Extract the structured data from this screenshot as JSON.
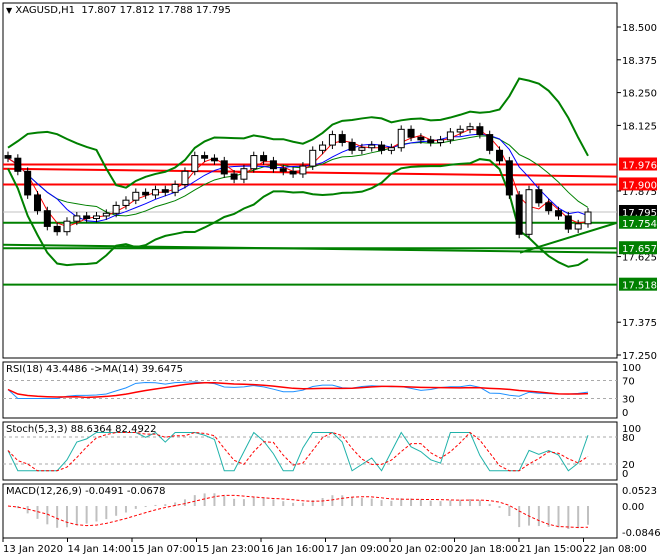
{
  "header": {
    "symbol": "XAGUSD,H1",
    "ohlc": "17.807 17.812 17.788 17.795"
  },
  "indicators": {
    "rsi": "RSI(18) 43.4486  ->MA(14) 39.6475",
    "stoch": "Stoch(5,3,3) 88.6364 82.4922",
    "macd": "MACD(12,26,9) -0.0491 -0.0678"
  },
  "chart_data": {
    "type": "candlestick",
    "title": "XAGUSD,H1",
    "ylim": [
      17.25,
      18.56
    ],
    "y_ticks": [
      "18.500",
      "18.375",
      "18.250",
      "18.125",
      "17.875",
      "17.625",
      "17.375",
      "17.250"
    ],
    "x_ticks": [
      "13 Jan 2020",
      "14 Jan 14:00",
      "15 Jan 07:00",
      "15 Jan 23:00",
      "16 Jan 16:00",
      "17 Jan 09:00",
      "20 Jan 02:00",
      "20 Jan 18:00",
      "21 Jan 15:00",
      "22 Jan 08:00"
    ],
    "closes": [
      18.0,
      17.95,
      17.86,
      17.8,
      17.74,
      17.72,
      17.76,
      17.78,
      17.77,
      17.78,
      17.79,
      17.82,
      17.84,
      17.87,
      17.86,
      17.88,
      17.87,
      17.9,
      17.95,
      18.01,
      18.0,
      17.99,
      17.94,
      17.92,
      17.96,
      18.01,
      17.99,
      17.96,
      17.95,
      17.94,
      17.97,
      18.03,
      18.05,
      18.09,
      18.06,
      18.03,
      18.04,
      18.05,
      18.03,
      18.04,
      18.11,
      18.08,
      18.07,
      18.06,
      18.07,
      18.1,
      18.11,
      18.12,
      18.09,
      18.03,
      17.99,
      17.86,
      17.71,
      17.88,
      17.83,
      17.8,
      17.78,
      17.73,
      17.75,
      17.795
    ],
    "levels": [
      {
        "value": "17.976",
        "color": "#ff0000"
      },
      {
        "value": "17.900",
        "color": "#ff0000"
      },
      {
        "value": "17.795",
        "color": "#000000"
      },
      {
        "value": "17.754",
        "color": "#008000"
      },
      {
        "value": "17.657",
        "color": "#008000"
      },
      {
        "value": "17.518",
        "color": "#008000"
      }
    ],
    "rsi_ticks": [
      "100",
      "70",
      "30",
      "0"
    ],
    "stoch_ticks": [
      "100",
      "80",
      "20",
      "0"
    ],
    "macd_ticks": [
      "0.0523",
      "0.00",
      "-0.0846"
    ]
  }
}
